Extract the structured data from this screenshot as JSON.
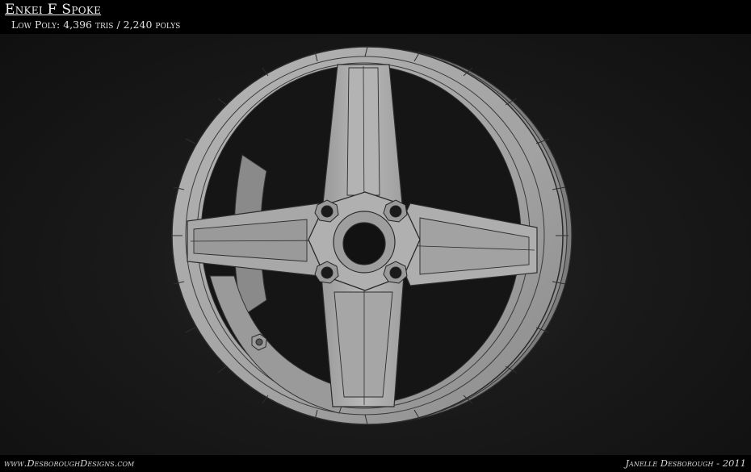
{
  "header": {
    "title": "Enkei F Spoke",
    "subtitle": "Low Poly: 4,396 tris / 2,240 polys"
  },
  "footer": {
    "site": "www.DesboroughDesigns.com",
    "credit": "Janelle Desborough - 2011"
  },
  "colors": {
    "page_background": "#0d0d0d",
    "bar_background": "#000000",
    "model_fill": "#a9a9a9",
    "model_shadow": "#5e5e5e",
    "wireframe": "#2e2e2e"
  }
}
